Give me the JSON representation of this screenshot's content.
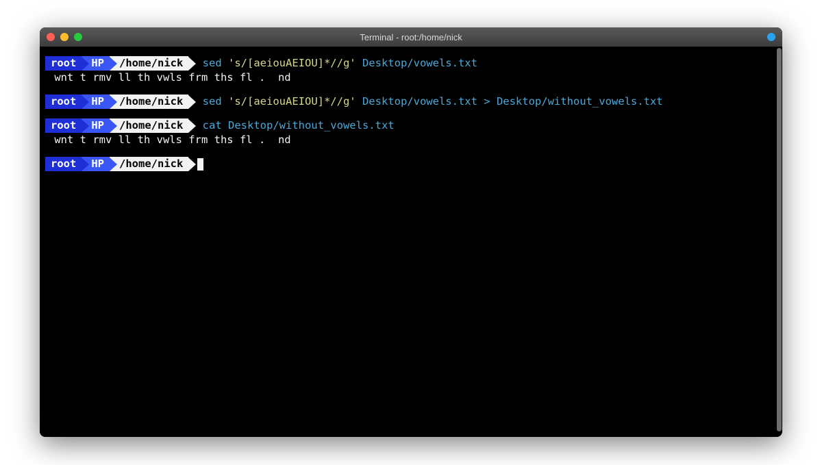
{
  "window": {
    "title": "Terminal - root:/home/nick"
  },
  "prompt": {
    "user": "root",
    "host": "HP",
    "path": "/home/nick"
  },
  "blocks": [
    {
      "command_parts": {
        "cmd": "sed ",
        "str": "'s/[aeiouAEIOU]*//g'",
        "rest": " Desktop/vowels.txt"
      },
      "output": " wnt t rmv ll th vwls frm ths fl .  nd"
    },
    {
      "command_parts": {
        "cmd": "sed ",
        "str": "'s/[aeiouAEIOU]*//g'",
        "rest": " Desktop/vowels.txt > Desktop/without_vowels.txt"
      },
      "output": null
    },
    {
      "command_parts": {
        "cmd": "cat Desktop/without_vowels.txt",
        "str": "",
        "rest": ""
      },
      "output": " wnt t rmv ll th vwls frm ths fl .  nd"
    },
    {
      "command_parts": null,
      "output": null
    }
  ]
}
